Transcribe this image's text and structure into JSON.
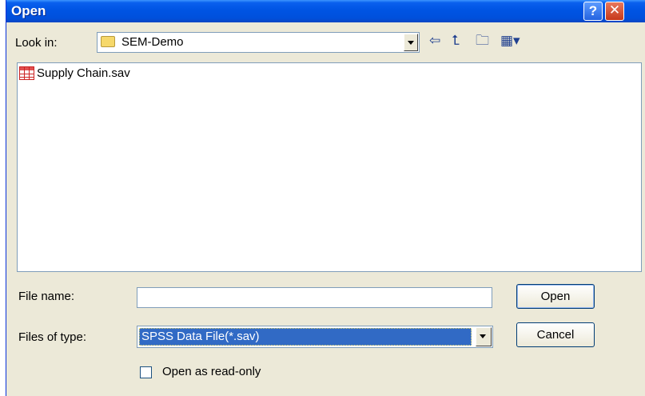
{
  "window": {
    "title": "Open"
  },
  "titlebar": {
    "help_glyph": "?",
    "close_glyph": "✕"
  },
  "look_in": {
    "label": "Look in:",
    "value": "SEM-Demo"
  },
  "toolbar": {
    "icons": [
      "back-arrow-icon",
      "up-folder-icon",
      "new-folder-icon",
      "view-menu-icon"
    ]
  },
  "files": [
    {
      "name": "Supply Chain.sav",
      "icon": "spss-data-file-icon"
    }
  ],
  "file_name": {
    "label": "File name:",
    "value": ""
  },
  "files_of_type": {
    "label": "Files of type:",
    "value": "SPSS Data File(*.sav)"
  },
  "buttons": {
    "open": "Open",
    "cancel": "Cancel"
  },
  "read_only": {
    "label": "Open as read-only",
    "checked": false
  },
  "colors": {
    "titlebar": "#0054e3",
    "dialog_bg": "#ece9d8",
    "selection": "#316ac5"
  }
}
